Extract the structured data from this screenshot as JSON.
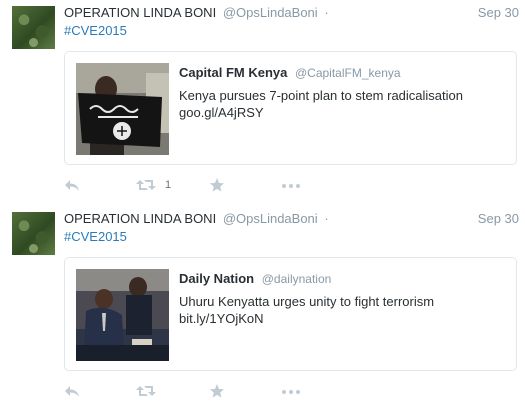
{
  "tweets": [
    {
      "author_name": "OPERATION LINDA BONI",
      "author_handle": "@OpsLindaBoni",
      "separator": "·",
      "date": "Sep 30",
      "hashtag": "#CVE2015",
      "card": {
        "title": "Capital FM Kenya",
        "handle": "@CapitalFM_kenya",
        "description": "Kenya pursues 7-point plan to stem radicalisation goo.gl/A4jRSY"
      },
      "retweet_count": "1"
    },
    {
      "author_name": "OPERATION LINDA BONI",
      "author_handle": "@OpsLindaBoni",
      "separator": "·",
      "date": "Sep 30",
      "hashtag": "#CVE2015",
      "card": {
        "title": "Daily Nation",
        "handle": "@dailynation",
        "description": "Uhuru Kenyatta urges unity to fight terrorism bit.ly/1YOjKoN"
      },
      "retweet_count": ""
    }
  ],
  "icons": {
    "reply": "reply-icon",
    "retweet": "retweet-icon",
    "favorite": "star-icon",
    "more": "more-dots-icon"
  },
  "colors": {
    "link": "#2b7bb9",
    "muted": "#8899a6",
    "action_icon": "#c0ccd4"
  }
}
